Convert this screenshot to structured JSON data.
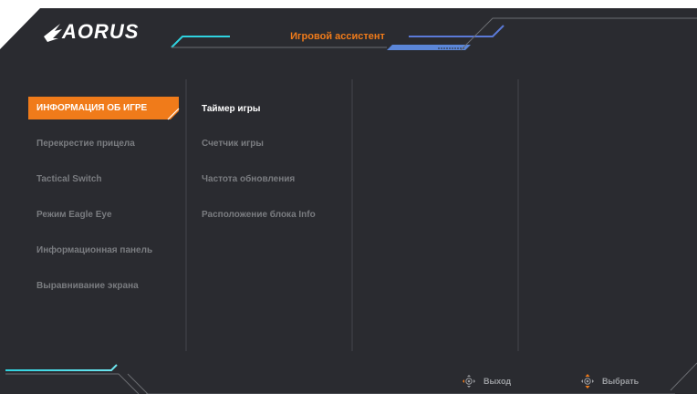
{
  "brand": {
    "logo_text": "AORUS"
  },
  "header": {
    "title": "Игровой ассистент"
  },
  "menu": {
    "items": [
      {
        "label": "ИНФОРМАЦИЯ ОБ ИГРЕ",
        "active": true
      },
      {
        "label": "Перекрестие прицела"
      },
      {
        "label": "Tactical Switch"
      },
      {
        "label": "Режим Eagle Eye"
      },
      {
        "label": "Информационная панель"
      },
      {
        "label": "Выравнивание экрана"
      }
    ]
  },
  "submenu": {
    "items": [
      {
        "label": "Таймер игры",
        "highlighted": true
      },
      {
        "label": "Счетчик игры"
      },
      {
        "label": "Частота обновления"
      },
      {
        "label": "Расположение блока Info"
      }
    ]
  },
  "footer": {
    "exit_label": "Выход",
    "exit_icon": "joystick-left-icon",
    "select_label": "Выбрать",
    "select_icon": "joystick-updown-icon"
  },
  "colors": {
    "accent_orange": "#f07b1a",
    "cyan": "#2fd3e0",
    "magenta": "#c23bd4",
    "panel_bg": "#2a2b30"
  }
}
